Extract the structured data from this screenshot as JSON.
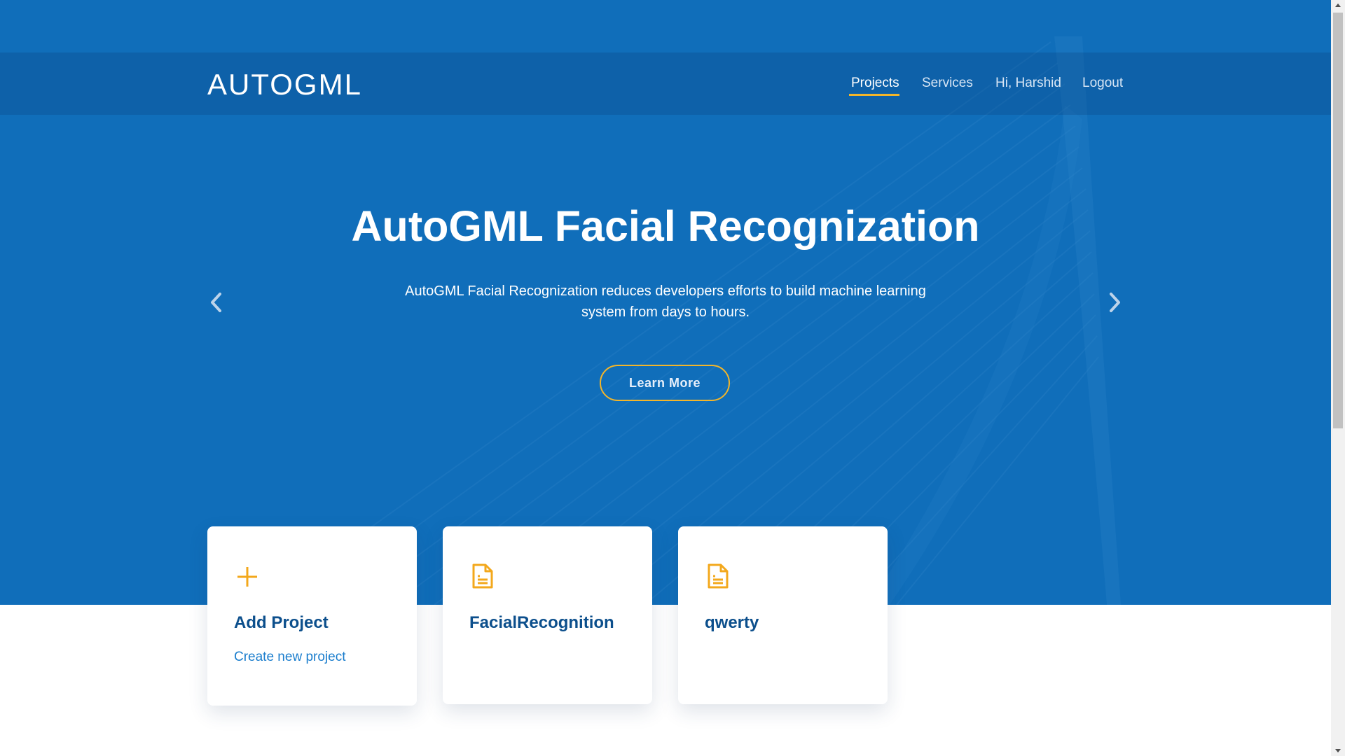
{
  "brand": {
    "name": "AUTOGML"
  },
  "nav": {
    "items": [
      {
        "label": "Projects",
        "active": true
      },
      {
        "label": "Services",
        "active": false
      },
      {
        "label": "Hi, Harshid",
        "active": false
      },
      {
        "label": "Logout",
        "active": false
      }
    ]
  },
  "hero": {
    "title": "AutoGML Facial Recognization",
    "description": "AutoGML Facial Recognization reduces developers efforts to build machine learning system from days to hours.",
    "button_label": "Learn More",
    "prev_icon": "chevron-left-icon",
    "next_icon": "chevron-right-icon"
  },
  "cards": [
    {
      "icon": "plus-icon",
      "title": "Add Project",
      "link": "Create new project"
    },
    {
      "icon": "document-icon",
      "title": "FacialRecognition",
      "link": ""
    },
    {
      "icon": "document-icon",
      "title": "qwerty",
      "link": ""
    }
  ],
  "colors": {
    "hero_bg": "#106eba",
    "accent": "#f3b52a",
    "card_title": "#0c4f8c",
    "card_link": "#1a7dcd"
  }
}
